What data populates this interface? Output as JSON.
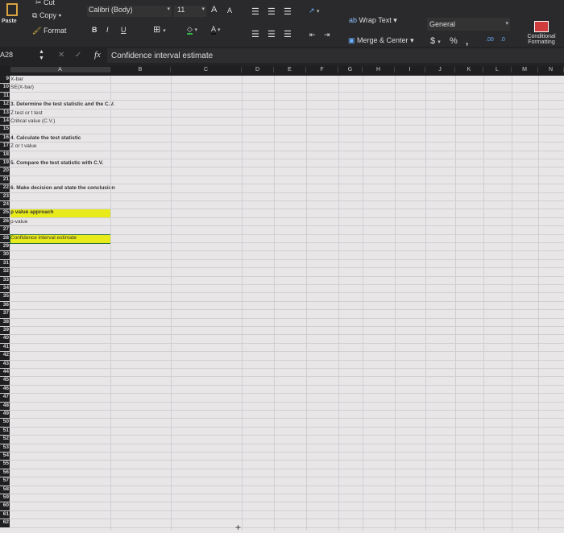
{
  "ribbon": {
    "clipboard": {
      "paste": "Paste",
      "cut": "Cut",
      "copy": "Copy",
      "format": "Format"
    },
    "font": {
      "name": "Calibri (Body)",
      "size": "11",
      "bold": "B",
      "italic": "I",
      "underline": "U",
      "grow": "A",
      "shrink": "A",
      "font_color": "A"
    },
    "alignment": {
      "wrap_text": "Wrap Text",
      "merge_center": "Merge & Center"
    },
    "number": {
      "format": "General",
      "currency": "$",
      "percent": "%",
      "comma": ","
    },
    "styles": {
      "conditional_formatting": "Conditional Formatting"
    }
  },
  "formula_bar": {
    "name_box": "A28",
    "fx": "fx",
    "value": "Confidence interval estimate"
  },
  "columns": [
    "A",
    "B",
    "C",
    "D",
    "E",
    "F",
    "G",
    "H",
    "I",
    "J",
    "K",
    "L",
    "M",
    "N"
  ],
  "rows": [
    {
      "n": "9",
      "a": "X-bar"
    },
    {
      "n": "10",
      "a": "SE(X-bar)"
    },
    {
      "n": "11",
      "a": ""
    },
    {
      "n": "12",
      "a": "3. Determine the test statistic and the C.V.",
      "bold": true
    },
    {
      "n": "13",
      "a": "Z test or t test"
    },
    {
      "n": "14",
      "a": "Critical value (C.V.)"
    },
    {
      "n": "15",
      "a": ""
    },
    {
      "n": "16",
      "a": "4. Calculate the test statistic",
      "bold": true
    },
    {
      "n": "17",
      "a": "Z or t value"
    },
    {
      "n": "18",
      "a": ""
    },
    {
      "n": "19",
      "a": "5. Compare the test statistic with C.V.",
      "bold": true
    },
    {
      "n": "20",
      "a": ""
    },
    {
      "n": "21",
      "a": ""
    },
    {
      "n": "22",
      "a": "6. Make decision and state the conclusion",
      "bold": true
    },
    {
      "n": "23",
      "a": ""
    },
    {
      "n": "24",
      "a": ""
    },
    {
      "n": "25",
      "a": "p value approach",
      "bold": true,
      "highlight": true
    },
    {
      "n": "26",
      "a": "p-value"
    },
    {
      "n": "27",
      "a": ""
    },
    {
      "n": "28",
      "a": "Confidence interval estimate",
      "highlight": true,
      "selected": true
    }
  ],
  "highlight_color": "#e8ea1a",
  "sheet": {
    "add": "+"
  }
}
